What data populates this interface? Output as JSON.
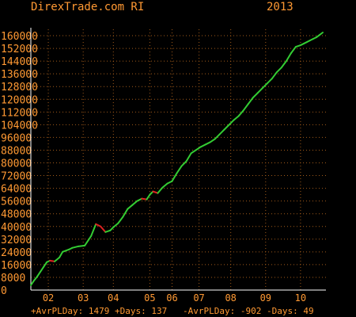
{
  "colors": {
    "background": "#000000",
    "text": "#ff9933",
    "grid": "#a05a1a",
    "axis": "#ffffff",
    "series_up": "#33cc33",
    "series_down": "#dd2222"
  },
  "chart_data": {
    "type": "line",
    "title": "DirexTrade.com RI",
    "year": "2013",
    "footer": "+AvrPLDay: 1479 +Days: 137   -AvrPLDay: -902 -Days: 49",
    "xlim": [
      0,
      186
    ],
    "ylim": [
      0,
      164000
    ],
    "y_ticks": [
      0,
      8000,
      16000,
      24000,
      32000,
      40000,
      48000,
      56000,
      64000,
      72000,
      80000,
      88000,
      96000,
      104000,
      112000,
      120000,
      128000,
      136000,
      144000,
      152000,
      160000
    ],
    "x_ticks": [
      {
        "label": "02",
        "x": 11
      },
      {
        "label": "03",
        "x": 33
      },
      {
        "label": "04",
        "x": 52
      },
      {
        "label": "05",
        "x": 75
      },
      {
        "label": "06",
        "x": 89
      },
      {
        "label": "07",
        "x": 106
      },
      {
        "label": "08",
        "x": 126
      },
      {
        "label": "09",
        "x": 148
      },
      {
        "label": "10",
        "x": 170
      }
    ],
    "grid": true,
    "series": [
      {
        "x": [
          0,
          2,
          4,
          6,
          8,
          10,
          12,
          15,
          18,
          20,
          24,
          26,
          30,
          34,
          38,
          41,
          44,
          47,
          50,
          52,
          55,
          58,
          61,
          64,
          67,
          70,
          73,
          75,
          77,
          80,
          83,
          86,
          89,
          92,
          95,
          98,
          101,
          104,
          107,
          110,
          113,
          116,
          119,
          122,
          125,
          128,
          131,
          134,
          137,
          140,
          143,
          146,
          149,
          152,
          155,
          158,
          161,
          164,
          167,
          170,
          172,
          174,
          176,
          178,
          180,
          182,
          184
        ],
        "values": [
          3000,
          6000,
          8500,
          11500,
          14500,
          17500,
          18500,
          18000,
          20500,
          24000,
          25500,
          26500,
          27500,
          28000,
          34000,
          41500,
          40000,
          36500,
          37500,
          39500,
          42000,
          46000,
          51000,
          53500,
          56000,
          57500,
          57000,
          60000,
          62000,
          61000,
          64500,
          67000,
          68500,
          73500,
          78000,
          81000,
          86000,
          88000,
          90000,
          91500,
          93000,
          95000,
          98000,
          101000,
          104000,
          107000,
          109500,
          113000,
          117000,
          121000,
          124000,
          127000,
          130000,
          133000,
          137000,
          140000,
          144000,
          149000,
          153000,
          154000,
          155000,
          156000,
          157000,
          158000,
          159000,
          160500,
          162000
        ]
      }
    ]
  }
}
